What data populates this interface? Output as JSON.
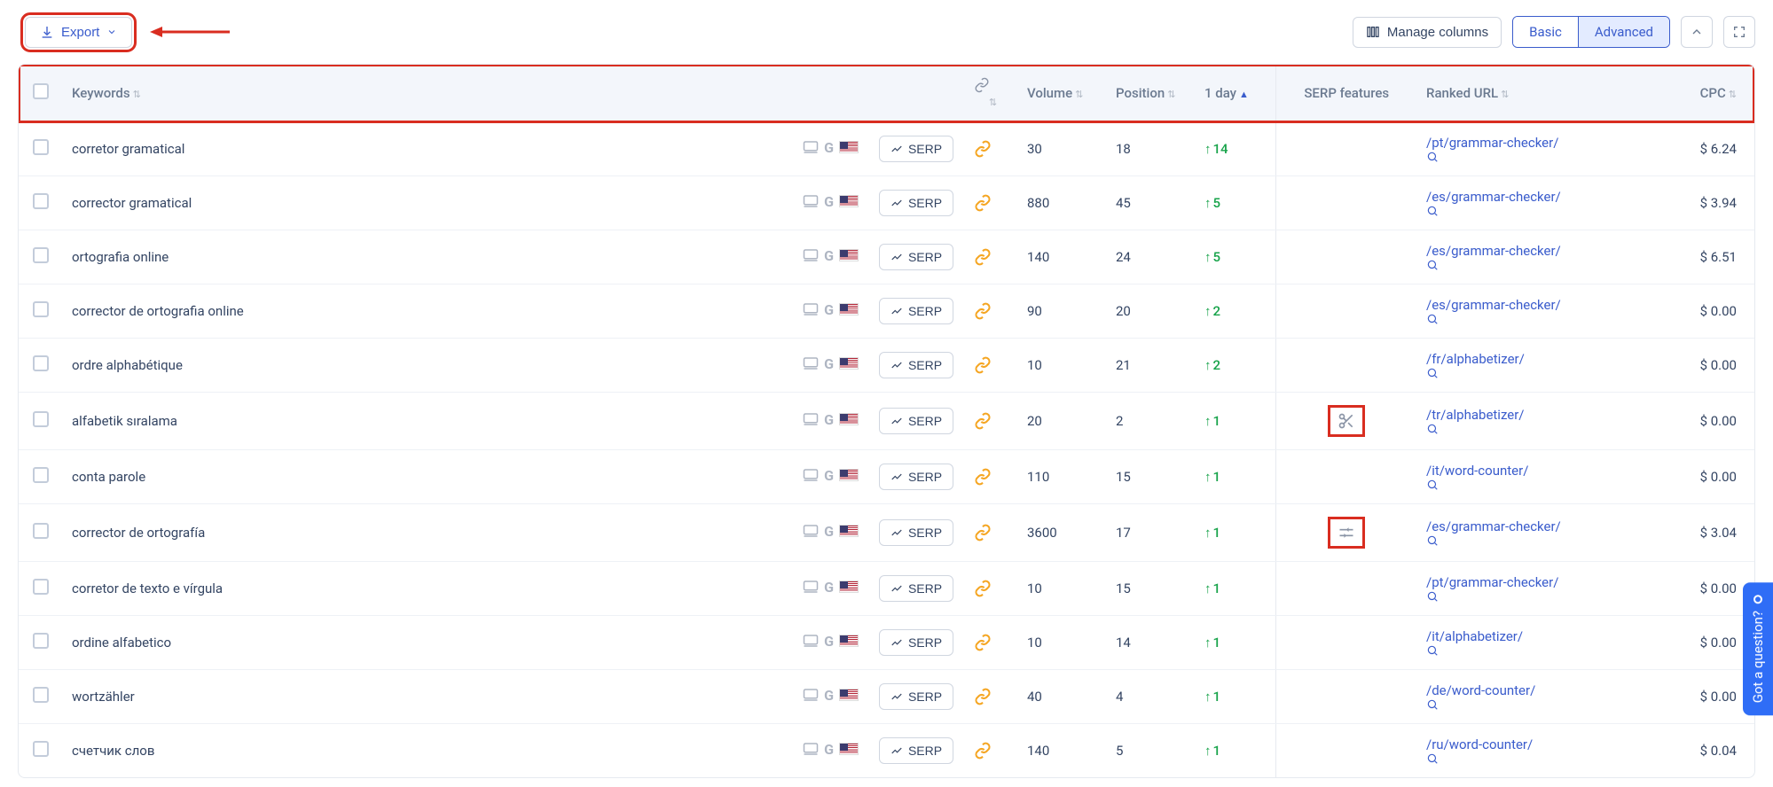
{
  "toolbar": {
    "export_label": "Export",
    "manage_columns_label": "Manage columns",
    "basic_label": "Basic",
    "advanced_label": "Advanced"
  },
  "columns": {
    "keywords": "Keywords",
    "volume": "Volume",
    "position": "Position",
    "day1": "1 day",
    "serp_features": "SERP features",
    "ranked_url": "Ranked URL",
    "cpc": "CPC"
  },
  "serp_button_label": "SERP",
  "rows": [
    {
      "keyword": "corretor gramatical",
      "volume": "30",
      "position": "18",
      "delta": "14",
      "feat": "",
      "url": "/pt/grammar-checker/",
      "cpc": "$ 6.24"
    },
    {
      "keyword": "corrector gramatical",
      "volume": "880",
      "position": "45",
      "delta": "5",
      "feat": "",
      "url": "/es/grammar-checker/",
      "cpc": "$ 3.94"
    },
    {
      "keyword": "ortografia online",
      "volume": "140",
      "position": "24",
      "delta": "5",
      "feat": "",
      "url": "/es/grammar-checker/",
      "cpc": "$ 6.51"
    },
    {
      "keyword": "corrector de ortografia online",
      "volume": "90",
      "position": "20",
      "delta": "2",
      "feat": "",
      "url": "/es/grammar-checker/",
      "cpc": "$ 0.00"
    },
    {
      "keyword": "ordre alphabétique",
      "volume": "10",
      "position": "21",
      "delta": "2",
      "feat": "",
      "url": "/fr/alphabetizer/",
      "cpc": "$ 0.00"
    },
    {
      "keyword": "alfabetik sıralama",
      "volume": "20",
      "position": "2",
      "delta": "1",
      "feat": "scissors",
      "url": "/tr/alphabetizer/",
      "cpc": "$ 0.00"
    },
    {
      "keyword": "conta parole",
      "volume": "110",
      "position": "15",
      "delta": "1",
      "feat": "",
      "url": "/it/word-counter/",
      "cpc": "$ 0.00"
    },
    {
      "keyword": "corrector de ortografía",
      "volume": "3600",
      "position": "17",
      "delta": "1",
      "feat": "sliders",
      "url": "/es/grammar-checker/",
      "cpc": "$ 3.04"
    },
    {
      "keyword": "corretor de texto e vírgula",
      "volume": "10",
      "position": "15",
      "delta": "1",
      "feat": "",
      "url": "/pt/grammar-checker/",
      "cpc": "$ 0.00"
    },
    {
      "keyword": "ordine alfabetico",
      "volume": "10",
      "position": "14",
      "delta": "1",
      "feat": "",
      "url": "/it/alphabetizer/",
      "cpc": "$ 0.00"
    },
    {
      "keyword": "wortzähler",
      "volume": "40",
      "position": "4",
      "delta": "1",
      "feat": "",
      "url": "/de/word-counter/",
      "cpc": "$ 0.00"
    },
    {
      "keyword": "счетчик слов",
      "volume": "140",
      "position": "5",
      "delta": "1",
      "feat": "",
      "url": "/ru/word-counter/",
      "cpc": "$ 0.04"
    }
  ],
  "help_widget_label": "Got a question?"
}
